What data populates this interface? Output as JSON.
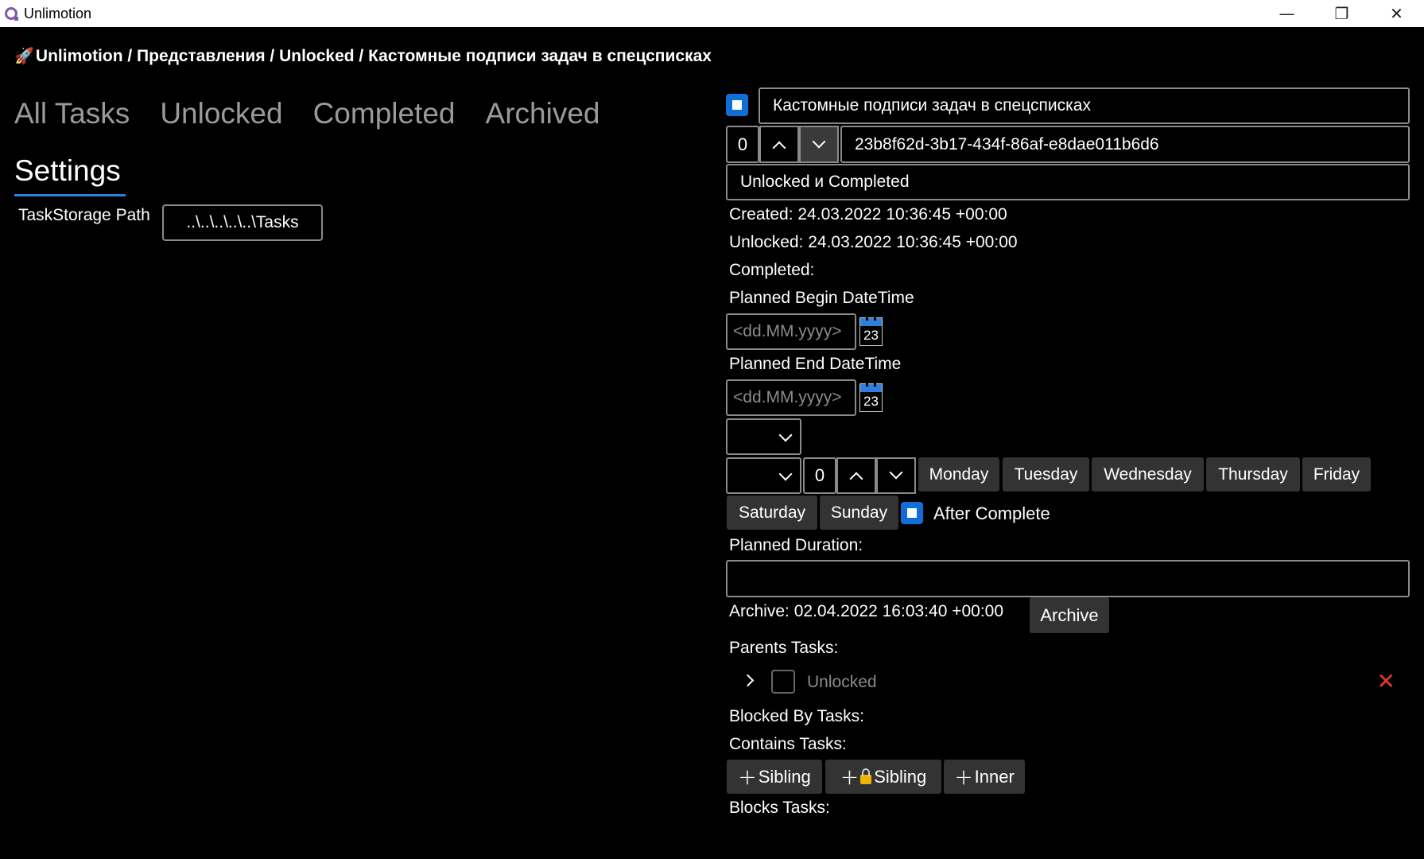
{
  "window": {
    "title": "Unlimotion",
    "minimize": "—",
    "restore": "❐",
    "close": "✕"
  },
  "breadcrumb": {
    "icon": "🚀",
    "text": "Unlimotion / Представления / Unlocked / Кастомные подписи задач в спецсписках"
  },
  "tabs": [
    {
      "label": "All Tasks"
    },
    {
      "label": "Unlocked"
    },
    {
      "label": "Completed"
    },
    {
      "label": "Archived"
    }
  ],
  "settings": {
    "tab_label": "Settings",
    "storage_label": "TaskStorage Path",
    "storage_value": "..\\..\\..\\..\\..\\Tasks"
  },
  "task": {
    "title": "Кастомные подписи задач в спецсписках",
    "importance": "0",
    "id": "23b8f62d-3b17-434f-86af-e8dae011b6d6",
    "description": "Unlocked и Completed",
    "created": "Created: 24.03.2022 10:36:45 +00:00",
    "unlocked": "Unlocked: 24.03.2022 10:36:45 +00:00",
    "completed": "Completed:",
    "planned_begin_label": "Planned Begin DateTime",
    "planned_begin_placeholder": "<dd.MM.yyyy>",
    "planned_end_label": "Planned End DateTime",
    "planned_end_placeholder": "<dd.MM.yyyy>",
    "calendar_day": "23",
    "repeat_period": "0",
    "days": [
      "Monday",
      "Tuesday",
      "Wednesday",
      "Thursday",
      "Friday",
      "Saturday",
      "Sunday"
    ],
    "after_complete": "After Complete",
    "planned_duration_label": "Planned Duration:",
    "planned_duration_value": "",
    "archive_text": "Archive: 02.04.2022 16:03:40 +00:00",
    "archive_button": "Archive",
    "parents_label": "Parents Tasks:",
    "parent_item": "Unlocked",
    "blocked_by_label": "Blocked By Tasks:",
    "contains_label": "Contains Tasks:",
    "add_sibling": "Sibling",
    "add_blocked_sibling": "Sibling",
    "add_inner": "Inner",
    "blocks_label": "Blocks Tasks:"
  },
  "colors": {
    "accent": "#0f6fd6",
    "remove": "#e03a2c",
    "button_bg": "#333333"
  }
}
